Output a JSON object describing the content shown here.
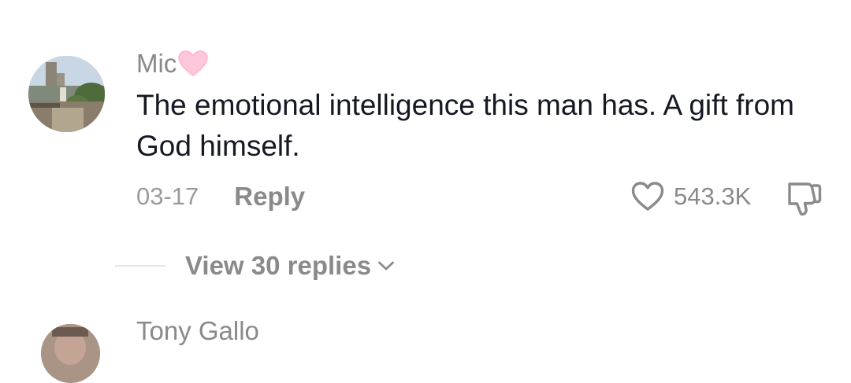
{
  "comment": {
    "username": "Mic",
    "username_emoji": "pink-heart-icon",
    "text": "The emotional intelligence this man has. A gift from God himself.",
    "date": "03-17",
    "reply_label": "Reply",
    "like_count": "543.3K",
    "like_icon": "heart-outline-icon",
    "dislike_icon": "thumbs-down-icon"
  },
  "replies": {
    "label": "View 30 replies",
    "icon": "chevron-down-icon"
  },
  "next_comment": {
    "username": "Tony Gallo"
  },
  "colors": {
    "primary_text": "#161823",
    "secondary_text": "#8a8a8a",
    "heart_emoji": "#ffc7dc",
    "divider": "#e6e6e6"
  }
}
